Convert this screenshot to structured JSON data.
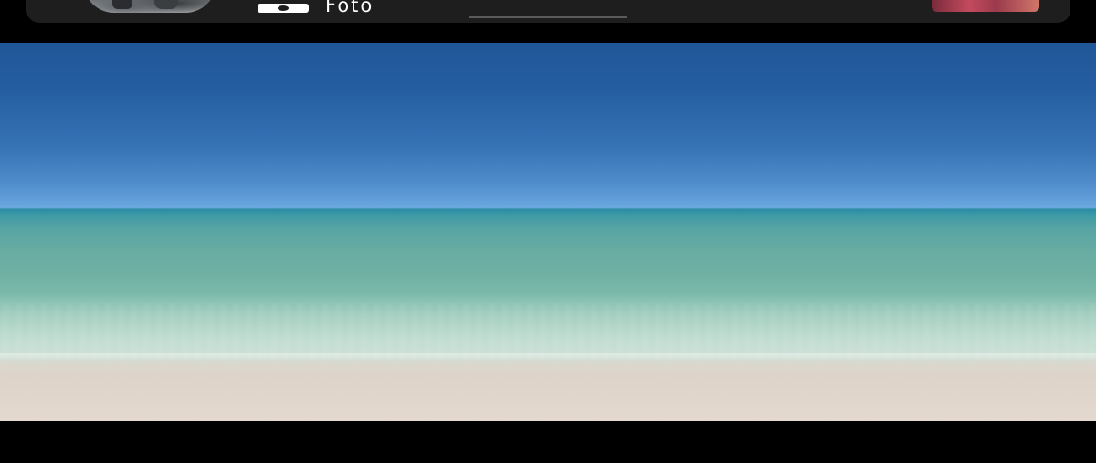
{
  "banner": {
    "media_label": "Foto",
    "camera_icon": "camera-icon",
    "background": "#1e1e1f"
  },
  "photo": {
    "subject": "",
    "colors": {
      "sky_top": "#1f5698",
      "sky_horizon": "#68a5de",
      "sea": "#57a4a4",
      "shallow_water": "#a4cfc0",
      "sand": "#e1d6cb"
    }
  }
}
